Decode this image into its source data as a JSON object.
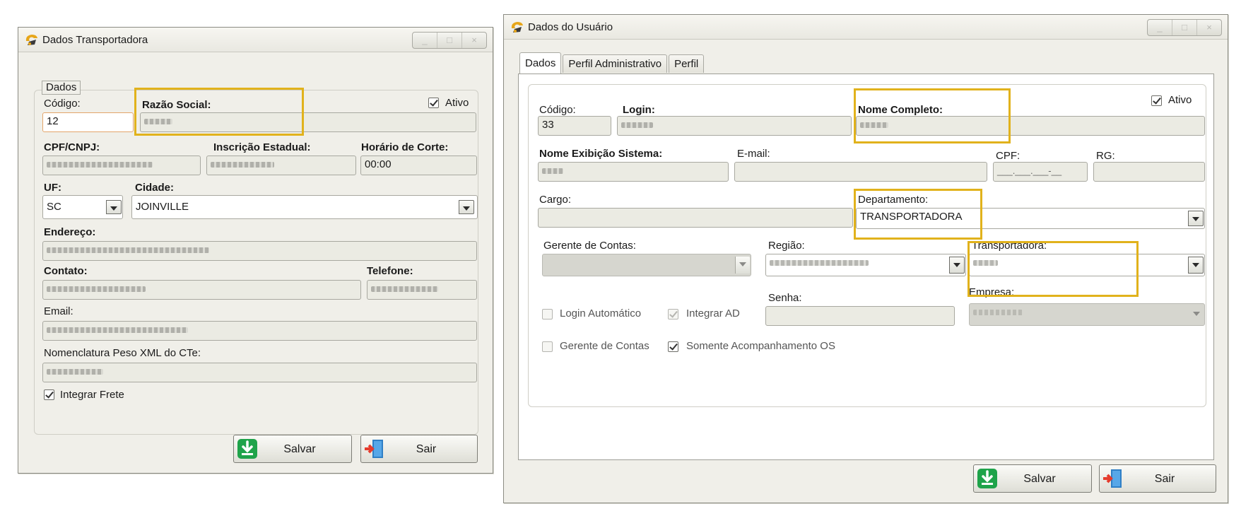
{
  "left_window": {
    "title": "Dados Transportadora",
    "controls": [
      "_",
      "□",
      "×"
    ],
    "group_title": "Dados",
    "labels": {
      "codigo": "Código:",
      "razao_social": "Razão Social:",
      "ativo": "Ativo",
      "cpf_cnpj": "CPF/CNPJ:",
      "inscricao_estadual": "Inscrição Estadual:",
      "horario_corte": "Horário de Corte:",
      "uf": "UF:",
      "cidade": "Cidade:",
      "endereco": "Endereço:",
      "contato": "Contato:",
      "telefone": "Telefone:",
      "email": "Email:",
      "nomenclatura": "Nomenclatura Peso XML do CTe:",
      "integrar_frete": "Integrar Frete"
    },
    "values": {
      "codigo": "12",
      "horario_corte": "00:00",
      "uf": "SC",
      "cidade": "JOINVILLE"
    },
    "checks": {
      "ativo": true,
      "integrar_frete": true
    },
    "buttons": {
      "salvar": "Salvar",
      "sair": "Sair"
    }
  },
  "right_window": {
    "title": "Dados do Usuário",
    "controls": [
      "_",
      "□",
      "×"
    ],
    "tabs": [
      "Dados",
      "Perfil Administrativo",
      "Perfil"
    ],
    "active_tab": "Dados",
    "labels": {
      "codigo": "Código:",
      "login": "Login:",
      "nome_completo": "Nome Completo:",
      "ativo": "Ativo",
      "nome_exibicao": "Nome Exibição Sistema:",
      "email": "E-mail:",
      "cpf": "CPF:",
      "rg": "RG:",
      "cargo": "Cargo:",
      "departamento": "Departamento:",
      "gerente_contas": "Gerente de Contas:",
      "regiao": "Região:",
      "transportadora": "Transportadora:",
      "senha": "Senha:",
      "empresa": "Empresa:",
      "login_automatico": "Login Automático",
      "integrar_ad": "Integrar AD",
      "gerente_contas_chk": "Gerente de Contas",
      "somente_acompanhamento": "Somente Acompanhamento OS"
    },
    "values": {
      "codigo": "33",
      "cpf_mask": "___.___.___-__",
      "departamento": "TRANSPORTADORA"
    },
    "checks": {
      "ativo": true,
      "login_automatico": false,
      "integrar_ad": true,
      "gerente_contas": false,
      "somente_acompanhamento": true
    },
    "buttons": {
      "salvar": "Salvar",
      "sair": "Sair"
    }
  },
  "colors": {
    "highlight": "#e1b21c",
    "window_bg": "#f0efe9",
    "field_bg": "#ebebe3"
  },
  "icons": [
    "app-logo-icon",
    "save-download-icon",
    "exit-door-icon"
  ]
}
